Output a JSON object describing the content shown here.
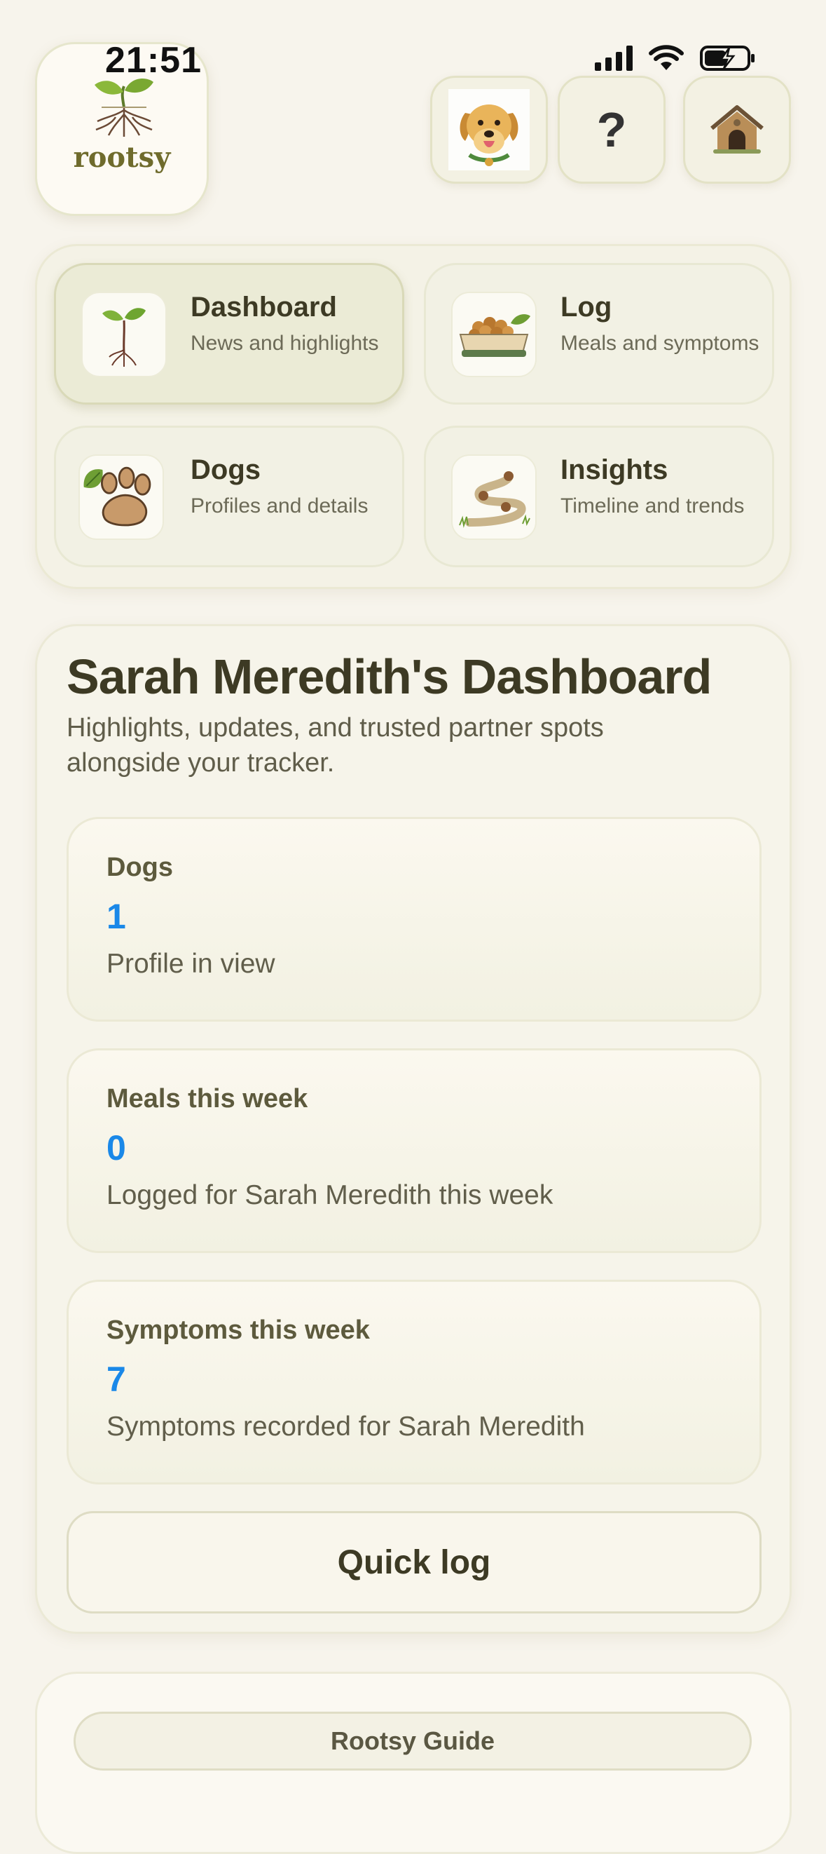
{
  "status_bar": {
    "time": "21:51"
  },
  "brand": {
    "name": "rootsy"
  },
  "header": {
    "help_label": "?"
  },
  "nav": {
    "items": [
      {
        "title": "Dashboard",
        "subtitle": "News and highlights",
        "icon": "sprout-icon",
        "active": true
      },
      {
        "title": "Log",
        "subtitle": "Meals and symptoms",
        "icon": "food-bowl-icon",
        "active": false
      },
      {
        "title": "Dogs",
        "subtitle": "Profiles and details",
        "icon": "paw-icon",
        "active": false
      },
      {
        "title": "Insights",
        "subtitle": "Timeline and trends",
        "icon": "trail-icon",
        "active": false
      }
    ]
  },
  "dashboard": {
    "title": "Sarah Meredith's Dashboard",
    "subtitle": "Highlights, updates, and trusted partner spots alongside your tracker.",
    "stats": [
      {
        "label": "Dogs",
        "value": "1",
        "description": "Profile in view"
      },
      {
        "label": "Meals this week",
        "value": "0",
        "description": "Logged for Sarah Meredith this week"
      },
      {
        "label": "Symptoms this week",
        "value": "7",
        "description": "Symptoms recorded for Sarah Meredith"
      }
    ],
    "quick_log_label": "Quick log"
  },
  "guide": {
    "button_label": "Rootsy Guide"
  },
  "colors": {
    "accent": "#1a88e8",
    "background": "#f7f4ec",
    "text": "#3d3a24"
  }
}
